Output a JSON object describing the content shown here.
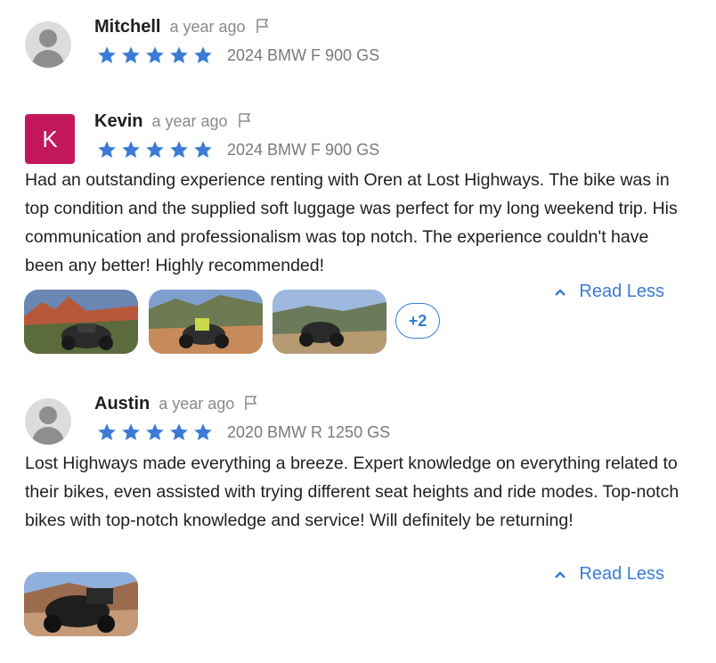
{
  "reviews": [
    {
      "name": "Mitchell",
      "time": "a year ago",
      "rating": 5,
      "vehicle": "2024 BMW F 900 GS",
      "avatar_type": "default"
    },
    {
      "name": "Kevin",
      "time": "a year ago",
      "rating": 5,
      "vehicle": "2024 BMW F 900 GS",
      "avatar_letter": "K",
      "avatar_color": "#c2185b",
      "text": "Had an outstanding experience renting with Oren at Lost Highways. The bike was in top condition and the supplied soft luggage was perfect for my long weekend trip. His communication and professionalism was top notch. The experience couldn't have been any better! Highly recommended!",
      "read_less": "Read Less",
      "more_photos": "+2"
    },
    {
      "name": "Austin",
      "time": "a year ago",
      "rating": 5,
      "vehicle": "2020 BMW R 1250 GS",
      "avatar_type": "default",
      "text": "Lost Highways made everything a breeze. Expert knowledge on everything related to their bikes, even assisted with trying different seat heights and ride modes. Top-notch bikes with top-notch knowledge and service! Will definitely be returning!",
      "read_less": "Read Less"
    }
  ],
  "colors": {
    "star": "#3a7bd5",
    "link": "#3a7bd5",
    "avatar_k": "#c2185b"
  }
}
